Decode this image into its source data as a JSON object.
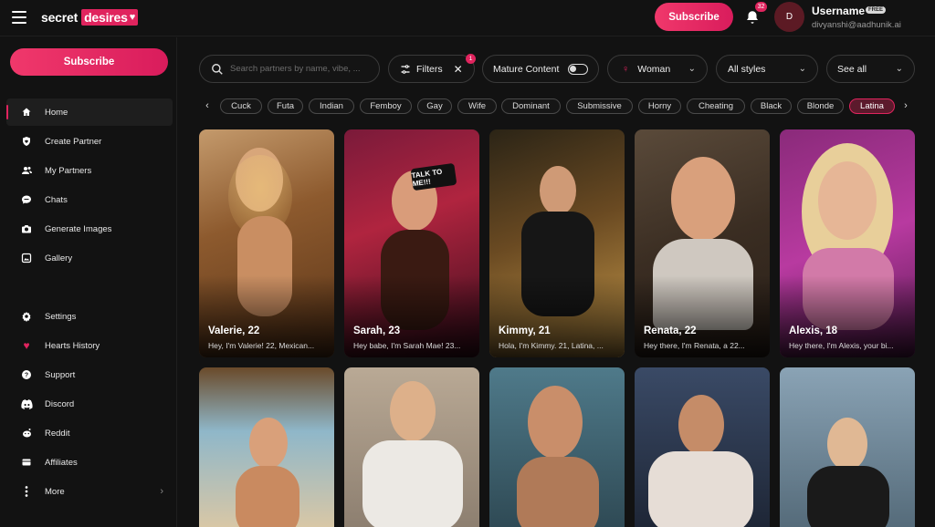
{
  "app": {
    "logo_part1": "secret",
    "logo_part2": "desires",
    "subscribe_label": "Subscribe"
  },
  "header": {
    "notification_count": "32",
    "avatar_initial": "D",
    "username": "Username",
    "plan_badge": "FREE",
    "email": "divyanshi@aadhunik.ai"
  },
  "sidebar": {
    "subscribe_label": "Subscribe",
    "items": [
      {
        "label": "Home",
        "icon": "home-icon"
      },
      {
        "label": "Create Partner",
        "icon": "heart-shield-icon"
      },
      {
        "label": "My Partners",
        "icon": "users-icon"
      },
      {
        "label": "Chats",
        "icon": "chat-icon"
      },
      {
        "label": "Generate Images",
        "icon": "camera-icon"
      },
      {
        "label": "Gallery",
        "icon": "gallery-icon"
      },
      {
        "label": "Settings",
        "icon": "gear-icon"
      },
      {
        "label": "Hearts History",
        "icon": "hearts-icon"
      },
      {
        "label": "Support",
        "icon": "help-icon"
      },
      {
        "label": "Discord",
        "icon": "discord-icon"
      },
      {
        "label": "Reddit",
        "icon": "reddit-icon"
      },
      {
        "label": "Affiliates",
        "icon": "affiliates-icon"
      },
      {
        "label": "More",
        "icon": "more-dots-icon"
      }
    ]
  },
  "filters": {
    "search_placeholder": "Search partners by name, vibe, ...",
    "filters_label": "Filters",
    "filters_count": "1",
    "mature_label": "Mature Content",
    "gender_label": "Woman",
    "styles_label": "All styles",
    "sort_label": "See all"
  },
  "tags": [
    "Cuck",
    "Futa",
    "Indian",
    "Femboy",
    "Gay",
    "Wife",
    "Dominant",
    "Submissive",
    "Horny",
    "Cheating",
    "Black",
    "Blonde",
    "Latina"
  ],
  "active_tag": "Latina",
  "cards": [
    {
      "name": "Valerie, 22",
      "bio": "Hey, I'm Valerie! 22, Mexican..."
    },
    {
      "name": "Sarah, 23",
      "bio": "Hey babe, I'm Sarah Mae! 23..."
    },
    {
      "name": "Kimmy, 21",
      "bio": "Hola, I'm Kimmy. 21, Latina, ..."
    },
    {
      "name": "Renata, 22",
      "bio": "Hey there, I'm Renata, a 22..."
    },
    {
      "name": "Alexis, 18",
      "bio": "Hey there, I'm Alexis, your bi..."
    }
  ],
  "colors": {
    "accent": "#e0245e",
    "background": "#121212"
  }
}
